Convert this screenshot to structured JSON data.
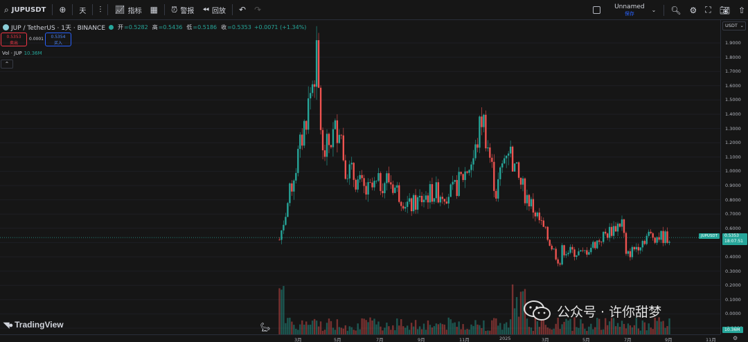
{
  "toolbar": {
    "symbol": "JUPUSDT",
    "interval": "天",
    "indicators_label": "指标",
    "alerts_label": "警报",
    "replay_label": "回放",
    "layout_name": "Unnamed",
    "layout_status": "保存"
  },
  "legend": {
    "title": "JUP / TetherUS · 1天 · BINANCE",
    "open_label": "开",
    "open_value": "=0.5282",
    "high_label": "高",
    "high_value": "=0.5436",
    "low_label": "低",
    "low_value": "=0.5186",
    "close_label": "收",
    "close_value": "=0.5353",
    "change": "+0.0071 (+1.34%)"
  },
  "trade": {
    "sell_price": "0.5353",
    "sell_label": "卖出",
    "spread": "0.0001",
    "buy_price": "0.5354",
    "buy_label": "买入"
  },
  "volume": {
    "label": "Vol · JUP",
    "value": "10.36M",
    "badge": "10.36M"
  },
  "price_axis": {
    "currency": "USDT",
    "ticks": [
      "1.9000",
      "1.8000",
      "1.7000",
      "1.6000",
      "1.5000",
      "1.4000",
      "1.3000",
      "1.2000",
      "1.1000",
      "1.0000",
      "0.9000",
      "0.8000",
      "0.7000",
      "0.6000",
      "0.5000",
      "0.4000",
      "0.3000",
      "0.2000",
      "0.1000",
      "0.0000",
      "-0.1000"
    ],
    "current_symbol_tag": "JUPUSDT",
    "current_price": "0.5353",
    "countdown": "18:07:51"
  },
  "time_axis": {
    "labels": [
      "3月",
      "5月",
      "7月",
      "9月",
      "11月",
      "2025",
      "3月",
      "5月",
      "7月",
      "9月",
      "11月"
    ]
  },
  "branding": {
    "tv_logo": "TradingView",
    "watermark": "公众号 · 许你甜梦"
  },
  "chart_data": {
    "type": "candlestick",
    "symbol": "JUPUSDT",
    "ylim": [
      -0.1,
      1.95
    ],
    "last_close": 0.5353,
    "monthly_closes": [
      {
        "x": "2024-02",
        "close": 0.52
      },
      {
        "x": "2024-03",
        "close": 1.2
      },
      {
        "x": "2024-04",
        "close": 1.1
      },
      {
        "x": "2024-05",
        "close": 1.05
      },
      {
        "x": "2024-06",
        "close": 0.85
      },
      {
        "x": "2024-07",
        "close": 0.95
      },
      {
        "x": "2024-08",
        "close": 0.75
      },
      {
        "x": "2024-09",
        "close": 0.85
      },
      {
        "x": "2024-10",
        "close": 0.85
      },
      {
        "x": "2024-11",
        "close": 1.1
      },
      {
        "x": "2024-12",
        "close": 0.85
      },
      {
        "x": "2025-01",
        "close": 0.95
      },
      {
        "x": "2025-02",
        "close": 0.65
      },
      {
        "x": "2025-03",
        "close": 0.45
      },
      {
        "x": "2025-04",
        "close": 0.42
      },
      {
        "x": "2025-05",
        "close": 0.55
      },
      {
        "x": "2025-06",
        "close": 0.4
      },
      {
        "x": "2025-07",
        "close": 0.55
      },
      {
        "x": "2025-08",
        "close": 0.5353
      }
    ],
    "peaks": [
      {
        "x": "2024-03",
        "high": 1.85
      },
      {
        "x": "2024-12",
        "high": 1.45
      },
      {
        "x": "2025-04",
        "low": 0.32
      }
    ],
    "colors": {
      "up": "#26a69a",
      "down": "#ef5350"
    }
  }
}
